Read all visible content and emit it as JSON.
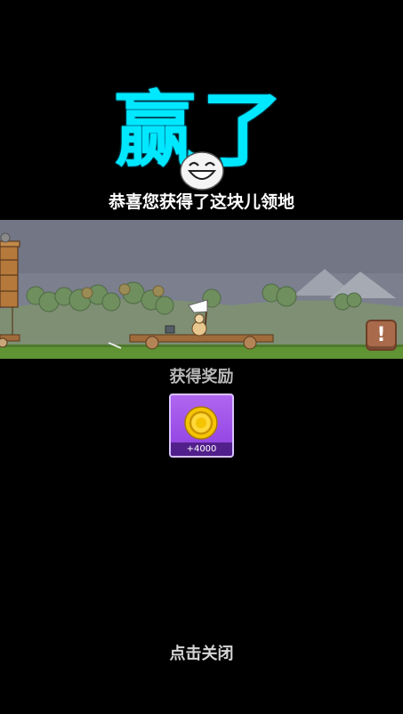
{
  "title": "赢了",
  "subtitle": "恭喜您获得了这块儿领地",
  "alert_button": "!",
  "reward": {
    "title": "获得奖励",
    "item_icon": "gold-coin-icon",
    "amount": "+4000"
  },
  "close_hint": "点击关闭",
  "colors": {
    "title": "#00e8ff",
    "card": "#9b4ee8",
    "alert_button": "#a86a4a"
  }
}
